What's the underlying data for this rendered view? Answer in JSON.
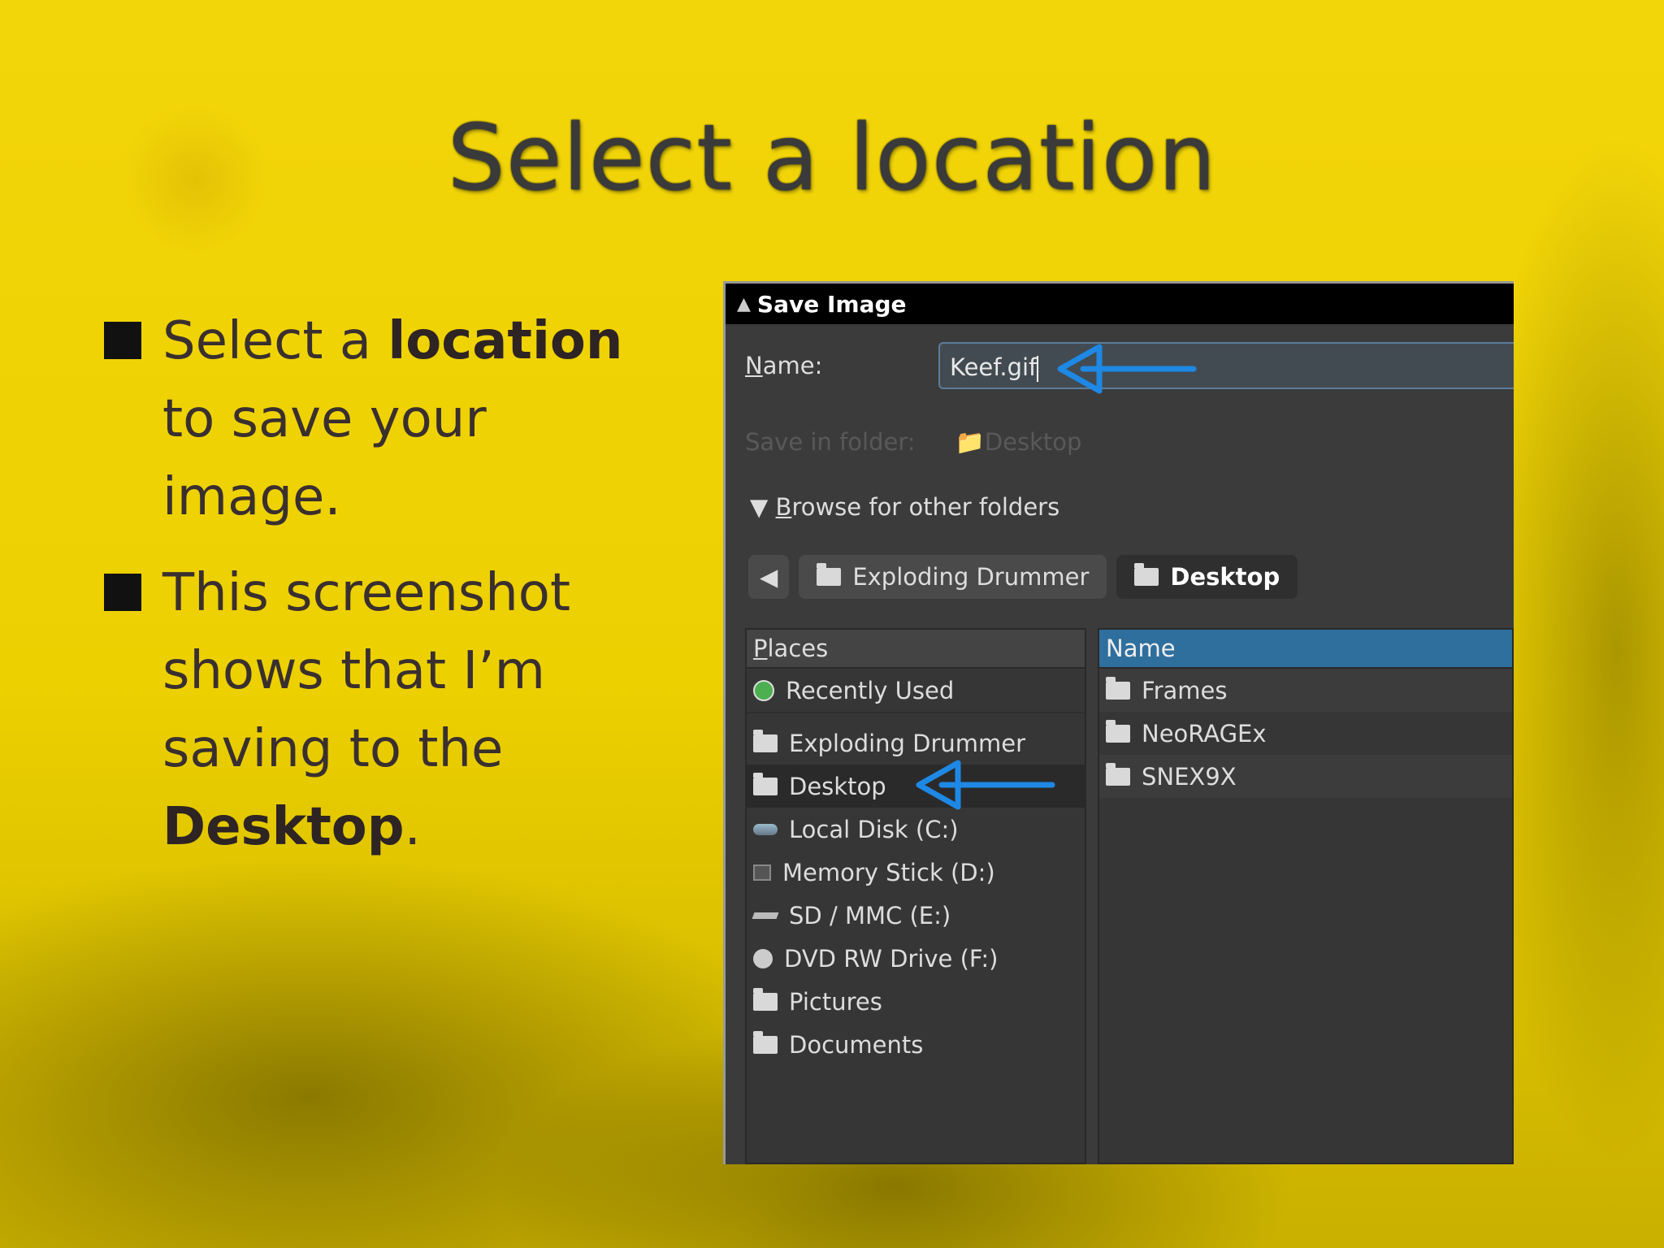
{
  "slide": {
    "title": "Select a location",
    "bullets": [
      {
        "pre": "Select a ",
        "bold": "location",
        "post": " to save your image."
      },
      {
        "pre": "This screenshot shows that I’m saving to the ",
        "bold": "Desktop",
        "post": "."
      }
    ]
  },
  "dialog": {
    "title": "Save Image",
    "name_label": "ame:",
    "name_label_mnemonic": "N",
    "name_value": "Keef.gif",
    "save_in_label": "Save in folder:",
    "save_in_value": "Desktop",
    "browse_label": "rowse for other folders",
    "browse_mnemonic": "B",
    "path": [
      "Exploding Drummer",
      "Desktop"
    ],
    "places_header_mnemonic": "P",
    "places_header": "laces",
    "places": [
      {
        "label": "Recently Used",
        "icon": "recent-icon"
      },
      {
        "label": "Exploding Drummer",
        "icon": "folder-icon"
      },
      {
        "label": "Desktop",
        "icon": "folder-icon"
      },
      {
        "label": "Local Disk (C:)",
        "icon": "disk-icon"
      },
      {
        "label": "Memory Stick (D:)",
        "icon": "stick-icon"
      },
      {
        "label": "SD / MMC (E:)",
        "icon": "sd-icon"
      },
      {
        "label": "DVD RW Drive (F:)",
        "icon": "dvd-icon"
      },
      {
        "label": "Pictures",
        "icon": "folder-icon"
      },
      {
        "label": "Documents",
        "icon": "folder-icon"
      }
    ],
    "files_header": "Name",
    "files": [
      "Frames",
      "NeoRAGEx",
      "SNEX9X"
    ]
  },
  "colors": {
    "arrow": "#1e88e5",
    "header_blue": "#2f6f9e"
  }
}
